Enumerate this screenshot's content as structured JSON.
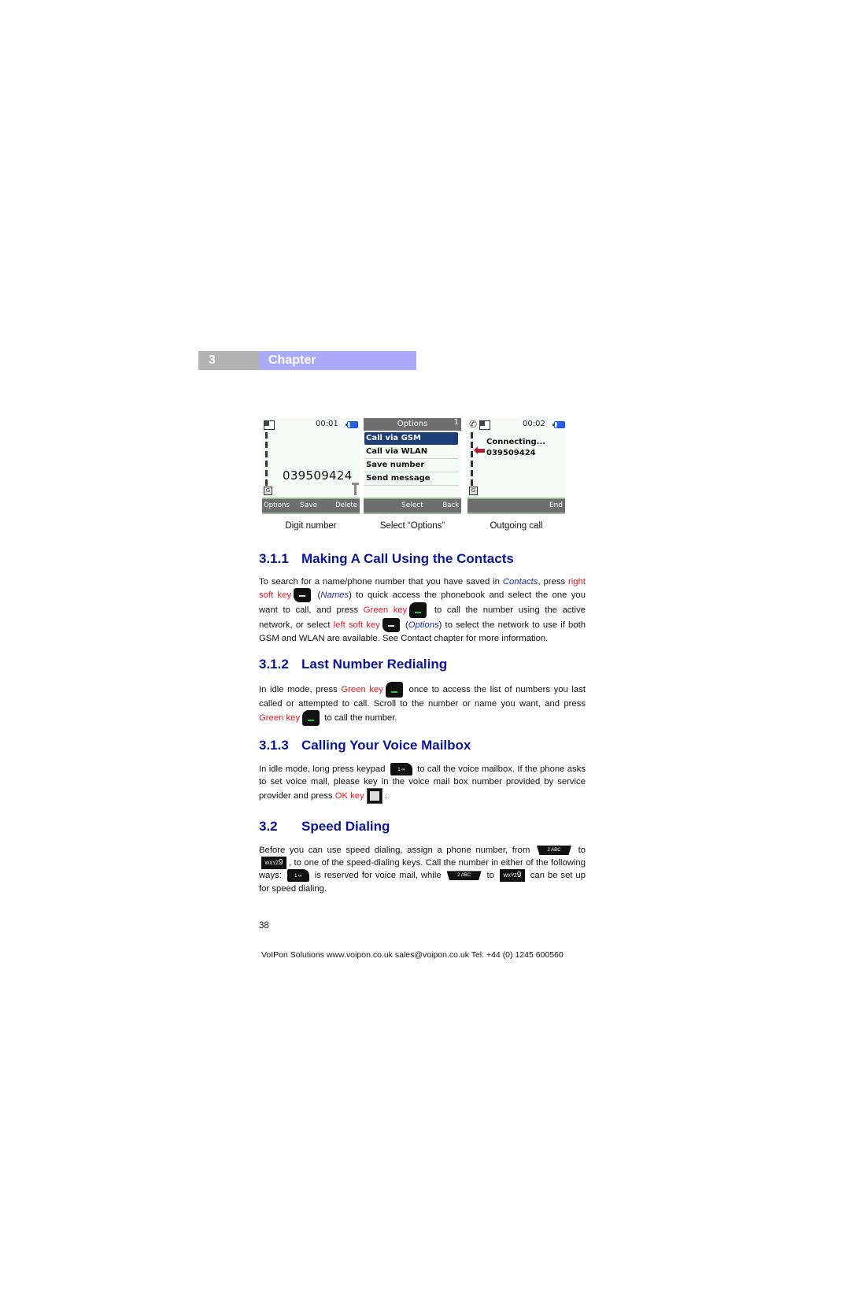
{
  "chapter": {
    "number": "3",
    "title": "Chapter"
  },
  "screens": [
    {
      "time": "00:01",
      "number": "039509424",
      "softkeys": {
        "left": "Options",
        "center": "Save",
        "right": "Delete"
      },
      "caption": "Digit number"
    },
    {
      "title": "Options",
      "page": "1",
      "items": [
        "Call via GSM",
        "Call via WLAN",
        "Save number",
        "Send message"
      ],
      "selected_index": 0,
      "softkeys": {
        "center": "Select",
        "right": "Back"
      },
      "caption": "Select “Options”"
    },
    {
      "time": "00:02",
      "status": "Connecting...",
      "number": "039509424",
      "softkeys": {
        "right": "End"
      },
      "caption": "Outgoing call"
    }
  ],
  "sections": [
    {
      "number": "3.1.1",
      "title": "Making A Call Using the Contacts",
      "text": {
        "p1": "To search for a name/phone number that you have saved in ",
        "contacts": "Contacts",
        "p2": ", press ",
        "right_soft_key": "right soft key",
        "names_open": " (",
        "names": "Names",
        "p3": ") to quick access the phonebook and select the one you want to call, and press ",
        "green_key": "Green key",
        "p4": " to call the number using the active network, or select ",
        "left_soft_key": "left soft key",
        "options_open": " (",
        "options": "Options",
        "p5": ") to select the network to use if both GSM and WLAN are available. See Contact chapter for more information."
      }
    },
    {
      "number": "3.1.2",
      "title": "Last Number Redialing",
      "text": {
        "p1": "In idle mode, press ",
        "green_key": "Green key",
        "p2": " once to access the list of numbers you last called or attempted to call. Scroll to the number or name you want, and press ",
        "green_key2": "Green key",
        "p3": " to call the number."
      }
    },
    {
      "number": "3.1.3",
      "title": "Calling Your Voice Mailbox",
      "text": {
        "p1": "In idle mode, long press keypad ",
        "p2": " to call the voice mailbox. If the phone asks to set voice mail, please key in the voice mail box number provided by service provider and press ",
        "ok_key": "OK key",
        "p3": "."
      }
    },
    {
      "number": "3.2",
      "title": "Speed Dialing",
      "text": {
        "p1": "Before you can use speed dialing, assign a phone number, from ",
        "to1": " to ",
        "p2": ", to one of the speed-dialing keys. Call the number in either of the following ways: ",
        "p3": " is reserved for voice mail, while ",
        "to2": " to ",
        "p4": " can be set up for speed dialing."
      }
    }
  ],
  "keys": {
    "key1": "1 ∞",
    "key2": "2 ABC",
    "key9_letters": "WXYZ",
    "key9_digit": "9"
  },
  "page_number": "38",
  "footer": "VoIPon Solutions  www.voipon.co.uk  sales@voipon.co.uk  Tel: +44 (0) 1245 600560"
}
